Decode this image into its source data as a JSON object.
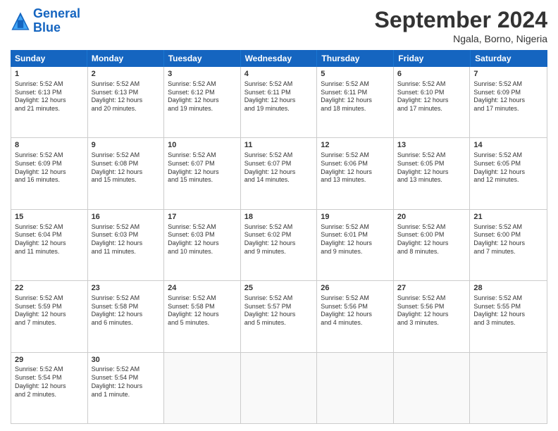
{
  "logo": {
    "line1": "General",
    "line2": "Blue"
  },
  "title": "September 2024",
  "subtitle": "Ngala, Borno, Nigeria",
  "header_days": [
    "Sunday",
    "Monday",
    "Tuesday",
    "Wednesday",
    "Thursday",
    "Friday",
    "Saturday"
  ],
  "rows": [
    [
      {
        "day": "1",
        "info": "Sunrise: 5:52 AM\nSunset: 6:13 PM\nDaylight: 12 hours\nand 21 minutes."
      },
      {
        "day": "2",
        "info": "Sunrise: 5:52 AM\nSunset: 6:13 PM\nDaylight: 12 hours\nand 20 minutes."
      },
      {
        "day": "3",
        "info": "Sunrise: 5:52 AM\nSunset: 6:12 PM\nDaylight: 12 hours\nand 19 minutes."
      },
      {
        "day": "4",
        "info": "Sunrise: 5:52 AM\nSunset: 6:11 PM\nDaylight: 12 hours\nand 19 minutes."
      },
      {
        "day": "5",
        "info": "Sunrise: 5:52 AM\nSunset: 6:11 PM\nDaylight: 12 hours\nand 18 minutes."
      },
      {
        "day": "6",
        "info": "Sunrise: 5:52 AM\nSunset: 6:10 PM\nDaylight: 12 hours\nand 17 minutes."
      },
      {
        "day": "7",
        "info": "Sunrise: 5:52 AM\nSunset: 6:09 PM\nDaylight: 12 hours\nand 17 minutes."
      }
    ],
    [
      {
        "day": "8",
        "info": "Sunrise: 5:52 AM\nSunset: 6:09 PM\nDaylight: 12 hours\nand 16 minutes."
      },
      {
        "day": "9",
        "info": "Sunrise: 5:52 AM\nSunset: 6:08 PM\nDaylight: 12 hours\nand 15 minutes."
      },
      {
        "day": "10",
        "info": "Sunrise: 5:52 AM\nSunset: 6:07 PM\nDaylight: 12 hours\nand 15 minutes."
      },
      {
        "day": "11",
        "info": "Sunrise: 5:52 AM\nSunset: 6:07 PM\nDaylight: 12 hours\nand 14 minutes."
      },
      {
        "day": "12",
        "info": "Sunrise: 5:52 AM\nSunset: 6:06 PM\nDaylight: 12 hours\nand 13 minutes."
      },
      {
        "day": "13",
        "info": "Sunrise: 5:52 AM\nSunset: 6:05 PM\nDaylight: 12 hours\nand 13 minutes."
      },
      {
        "day": "14",
        "info": "Sunrise: 5:52 AM\nSunset: 6:05 PM\nDaylight: 12 hours\nand 12 minutes."
      }
    ],
    [
      {
        "day": "15",
        "info": "Sunrise: 5:52 AM\nSunset: 6:04 PM\nDaylight: 12 hours\nand 11 minutes."
      },
      {
        "day": "16",
        "info": "Sunrise: 5:52 AM\nSunset: 6:03 PM\nDaylight: 12 hours\nand 11 minutes."
      },
      {
        "day": "17",
        "info": "Sunrise: 5:52 AM\nSunset: 6:03 PM\nDaylight: 12 hours\nand 10 minutes."
      },
      {
        "day": "18",
        "info": "Sunrise: 5:52 AM\nSunset: 6:02 PM\nDaylight: 12 hours\nand 9 minutes."
      },
      {
        "day": "19",
        "info": "Sunrise: 5:52 AM\nSunset: 6:01 PM\nDaylight: 12 hours\nand 9 minutes."
      },
      {
        "day": "20",
        "info": "Sunrise: 5:52 AM\nSunset: 6:00 PM\nDaylight: 12 hours\nand 8 minutes."
      },
      {
        "day": "21",
        "info": "Sunrise: 5:52 AM\nSunset: 6:00 PM\nDaylight: 12 hours\nand 7 minutes."
      }
    ],
    [
      {
        "day": "22",
        "info": "Sunrise: 5:52 AM\nSunset: 5:59 PM\nDaylight: 12 hours\nand 7 minutes."
      },
      {
        "day": "23",
        "info": "Sunrise: 5:52 AM\nSunset: 5:58 PM\nDaylight: 12 hours\nand 6 minutes."
      },
      {
        "day": "24",
        "info": "Sunrise: 5:52 AM\nSunset: 5:58 PM\nDaylight: 12 hours\nand 5 minutes."
      },
      {
        "day": "25",
        "info": "Sunrise: 5:52 AM\nSunset: 5:57 PM\nDaylight: 12 hours\nand 5 minutes."
      },
      {
        "day": "26",
        "info": "Sunrise: 5:52 AM\nSunset: 5:56 PM\nDaylight: 12 hours\nand 4 minutes."
      },
      {
        "day": "27",
        "info": "Sunrise: 5:52 AM\nSunset: 5:56 PM\nDaylight: 12 hours\nand 3 minutes."
      },
      {
        "day": "28",
        "info": "Sunrise: 5:52 AM\nSunset: 5:55 PM\nDaylight: 12 hours\nand 3 minutes."
      }
    ],
    [
      {
        "day": "29",
        "info": "Sunrise: 5:52 AM\nSunset: 5:54 PM\nDaylight: 12 hours\nand 2 minutes."
      },
      {
        "day": "30",
        "info": "Sunrise: 5:52 AM\nSunset: 5:54 PM\nDaylight: 12 hours\nand 1 minute."
      },
      {
        "day": "",
        "info": ""
      },
      {
        "day": "",
        "info": ""
      },
      {
        "day": "",
        "info": ""
      },
      {
        "day": "",
        "info": ""
      },
      {
        "day": "",
        "info": ""
      }
    ]
  ]
}
